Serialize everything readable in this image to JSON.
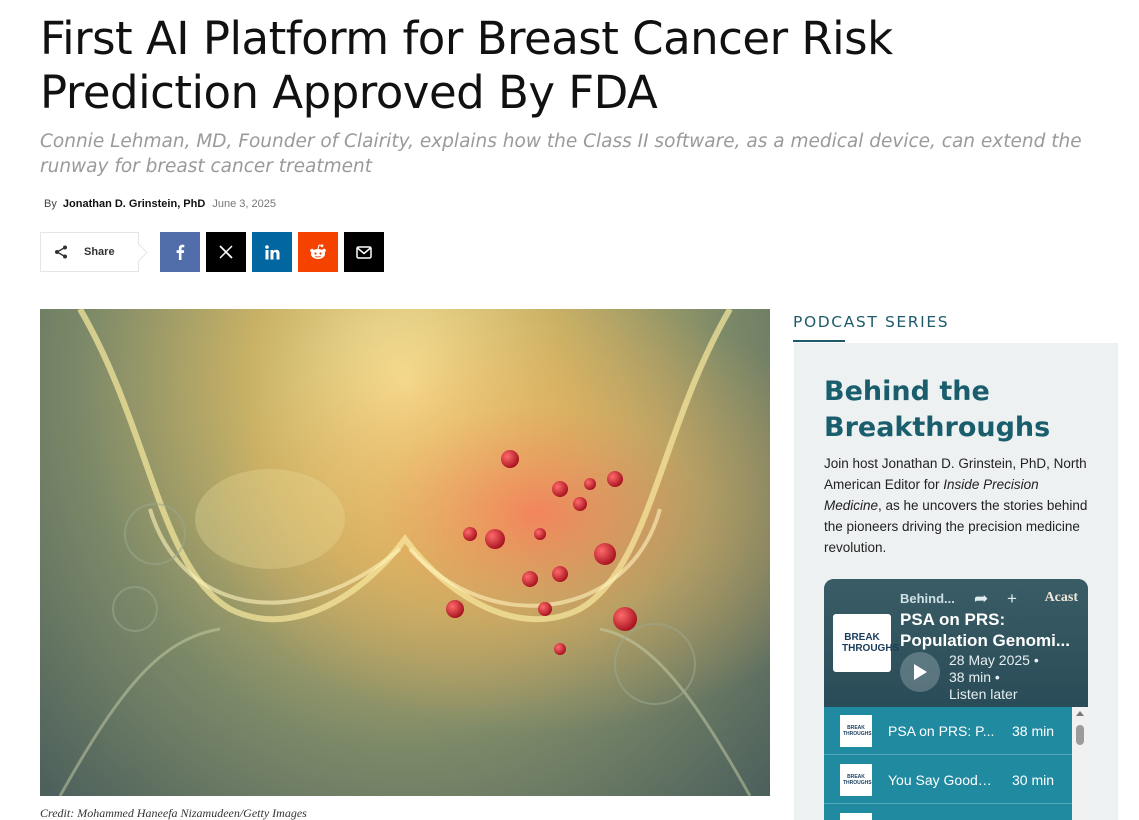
{
  "article": {
    "headline": "First AI Platform for Breast Cancer Risk Prediction Approved By FDA",
    "subtitle": "Connie Lehman, MD, Founder of Clairity, explains how the Class II software, as a medical device, can extend the runway for breast cancer treatment",
    "by_label": "By",
    "author": "Jonathan D. Grinstein, PhD",
    "date": "June 3, 2025",
    "share_label": "Share",
    "image_credit": "Credit: Mohammed Haneefa Nizamudeen/Getty Images",
    "share_icons": [
      "share-icon",
      "facebook-icon",
      "x-icon",
      "linkedin-icon",
      "reddit-icon",
      "email-icon"
    ],
    "share_colors": {
      "facebook": "#516eab",
      "x": "#000000",
      "linkedin": "#0266a0",
      "reddit": "#f54200",
      "email": "#000000"
    }
  },
  "sidebar": {
    "section_title": "PODCAST SERIES",
    "podcast_title": "Behind the Breakthroughs",
    "desc_before": "Join host Jonathan D. Grinstein, PhD, North American Editor for ",
    "desc_italic": "Inside Precision Medicine",
    "desc_after": ", as he uncovers the stories behind the pioneers driving the precision medicine revolution.",
    "accent_color": "#1a5e6d"
  },
  "player": {
    "show_name": "Behind...",
    "brand": "Acast",
    "episode_line1": "PSA on PRS:",
    "episode_line2": "Population Genomi...",
    "date": "28 May 2025 •",
    "duration": "38 min •",
    "listen_later": "Listen later",
    "cover_text": "BREAK THROUGHS",
    "episodes": [
      {
        "title": "PSA on PRS: P...",
        "duration": "38 min"
      },
      {
        "title": "You Say Goodb...",
        "duration": "30 min"
      }
    ]
  }
}
